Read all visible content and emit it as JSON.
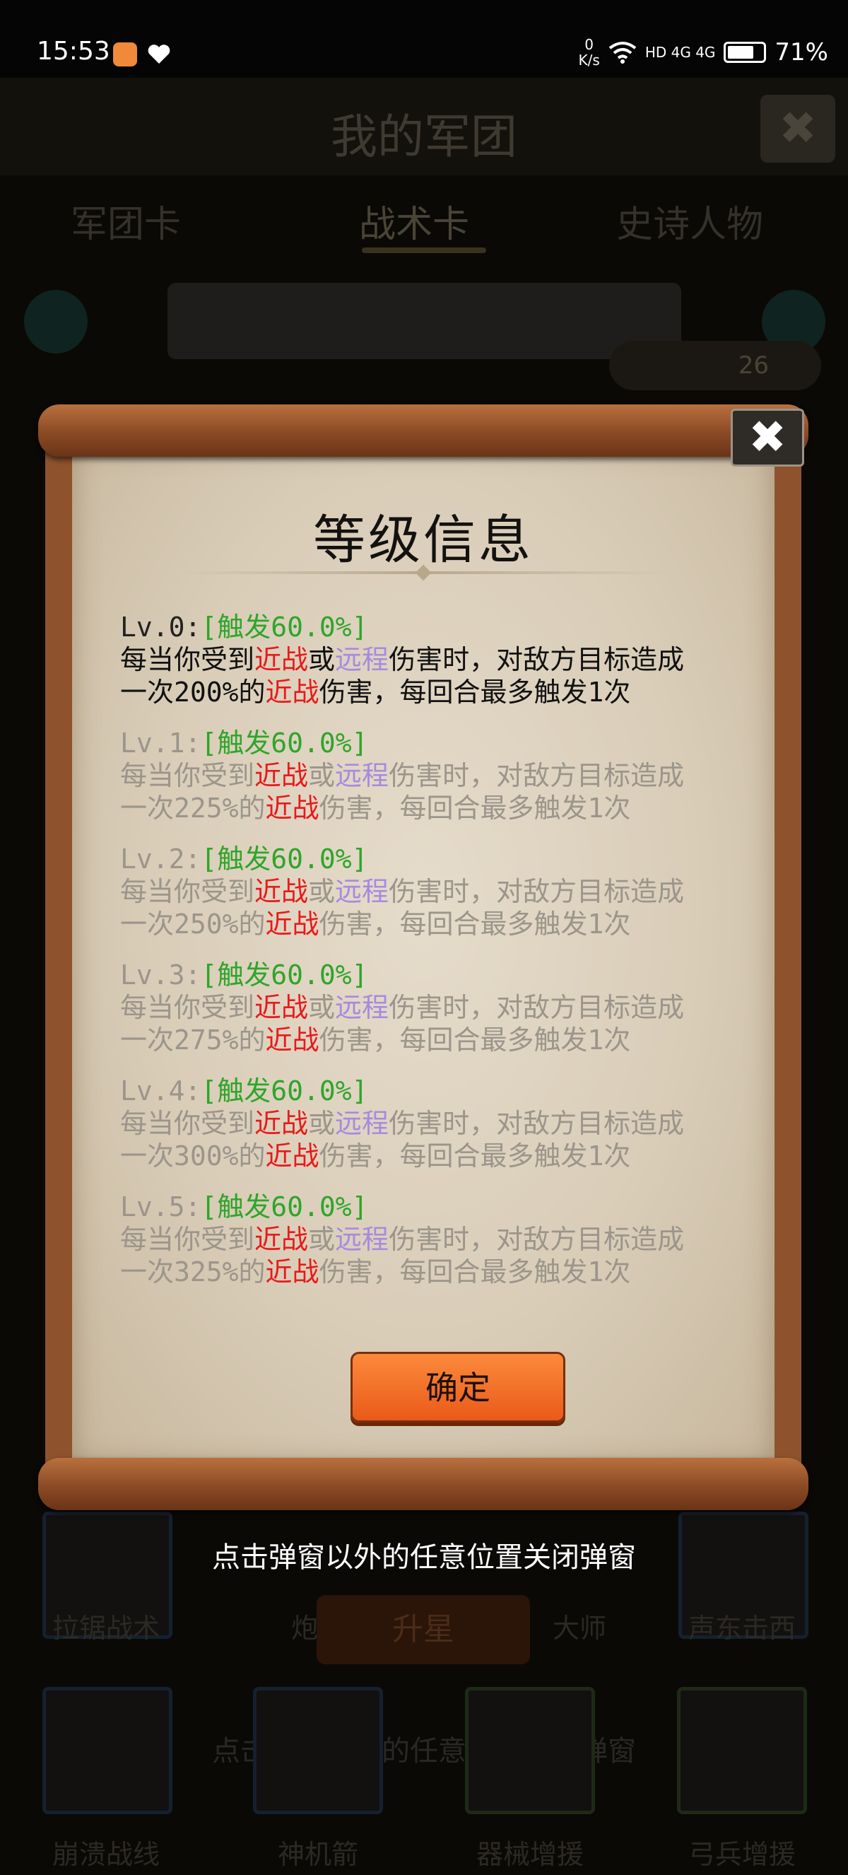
{
  "status_bar": {
    "time": "15:53",
    "net_speed_value": "0",
    "net_speed_unit": "K/s",
    "signal": "HD 4G 4G",
    "battery": "71%"
  },
  "background": {
    "title": "我的军团",
    "close_icon": "✖",
    "tabs": [
      "军团卡",
      "战术卡",
      "史诗人物"
    ],
    "coin_count": "26",
    "card_labels_row1": [
      "拉锯战术",
      "炮火",
      "大师",
      "声东击西"
    ],
    "upgrade_label": "升星",
    "hint_text": "点击弹窗以外的任意位置关闭弹窗",
    "card_labels_row2": [
      "崩溃战线",
      "神机箭",
      "器械增援",
      "弓兵增援"
    ]
  },
  "dialog": {
    "title": "等级信息",
    "close_icon": "✖",
    "levels": [
      {
        "level": "Lv.0:",
        "trigger": "[触发60.0%]",
        "pre": "每当你受到",
        "melee": "近战",
        "or": "或",
        "ranged": "远程",
        "mid": "伤害时，对敌方目标造成",
        "line2a": "一次200%的",
        "melee2": "近战",
        "line2b": "伤害，每回合最多触发1次"
      },
      {
        "level": "Lv.1:",
        "trigger": "[触发60.0%]",
        "pre": "每当你受到",
        "melee": "近战",
        "or": "或",
        "ranged": "远程",
        "mid": "伤害时，对敌方目标造成",
        "line2a": "一次225%的",
        "melee2": "近战",
        "line2b": "伤害，每回合最多触发1次"
      },
      {
        "level": "Lv.2:",
        "trigger": "[触发60.0%]",
        "pre": "每当你受到",
        "melee": "近战",
        "or": "或",
        "ranged": "远程",
        "mid": "伤害时，对敌方目标造成",
        "line2a": "一次250%的",
        "melee2": "近战",
        "line2b": "伤害，每回合最多触发1次"
      },
      {
        "level": "Lv.3:",
        "trigger": "[触发60.0%]",
        "pre": "每当你受到",
        "melee": "近战",
        "or": "或",
        "ranged": "远程",
        "mid": "伤害时，对敌方目标造成",
        "line2a": "一次275%的",
        "melee2": "近战",
        "line2b": "伤害，每回合最多触发1次"
      },
      {
        "level": "Lv.4:",
        "trigger": "[触发60.0%]",
        "pre": "每当你受到",
        "melee": "近战",
        "or": "或",
        "ranged": "远程",
        "mid": "伤害时，对敌方目标造成",
        "line2a": "一次300%的",
        "melee2": "近战",
        "line2b": "伤害，每回合最多触发1次"
      },
      {
        "level": "Lv.5:",
        "trigger": "[触发60.0%]",
        "pre": "每当你受到",
        "melee": "近战",
        "or": "或",
        "ranged": "远程",
        "mid": "伤害时，对敌方目标造成",
        "line2a": "一次325%的",
        "melee2": "近战",
        "line2b": "伤害，每回合最多触发1次"
      }
    ],
    "confirm_label": "确定"
  },
  "overlay_hint": "点击弹窗以外的任意位置关闭弹窗",
  "colors": {
    "trigger_green": "#2fa52a",
    "melee_red": "#e81a1a",
    "ranged_purple": "#a78ae0",
    "button_orange": "#f36f2a",
    "paper": "#e6dccb",
    "wood": "#8e532c"
  }
}
